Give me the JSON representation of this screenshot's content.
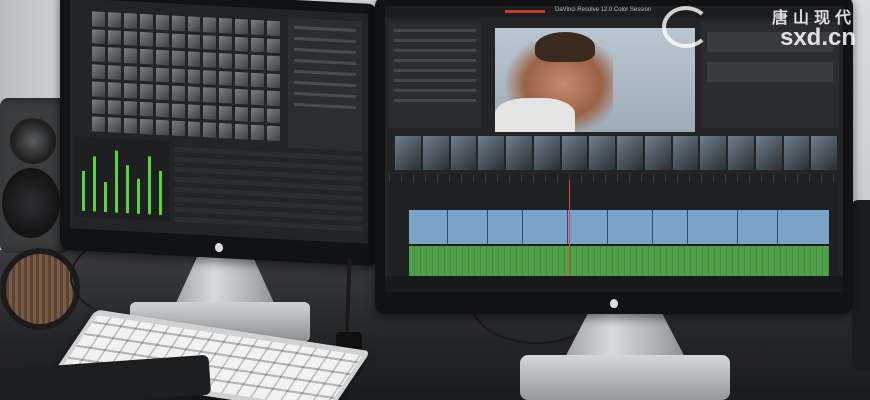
{
  "scene": {
    "description_objects": [
      "wall",
      "desk",
      "speaker",
      "headphones",
      "left-monitor",
      "right-monitor",
      "keyboard",
      "drawing-tablet",
      "stylus-pen"
    ]
  },
  "right_screen": {
    "window_title": "DaVinci Resolve 12.0 Color Session"
  },
  "watermark": {
    "chinese": "唐山现代",
    "latin": "sxd.cn"
  },
  "colors": {
    "video_track": "#7aa3c9",
    "audio_track": "#4f9f4b",
    "playhead": "#e04338",
    "meter_green": "#5bd13c",
    "ui_dark": "#232427"
  }
}
